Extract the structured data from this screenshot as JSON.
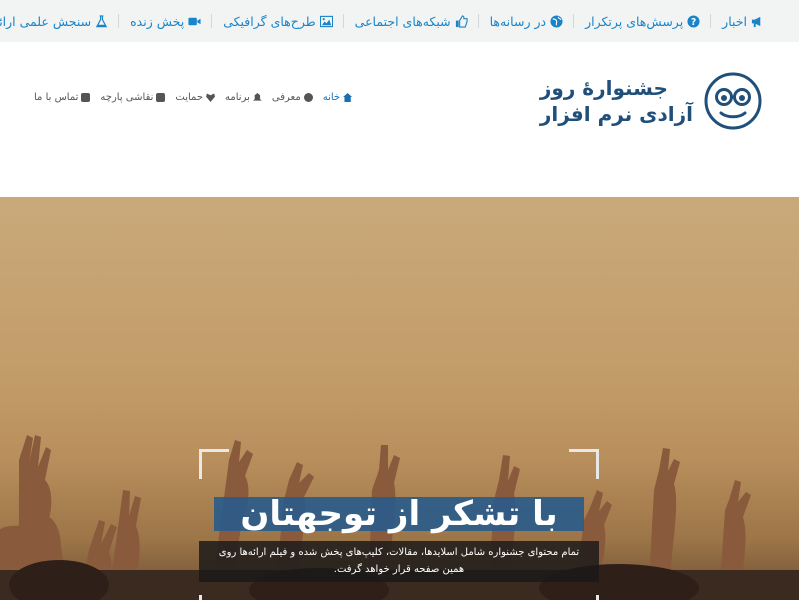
{
  "topbar": {
    "items": [
      {
        "label": "اخبار",
        "icon": "megaphone-icon"
      },
      {
        "label": "پرسش‌های پرتکرار",
        "icon": "question-icon"
      },
      {
        "label": "در رسانه‌ها",
        "icon": "globe-icon"
      },
      {
        "label": "شبکه‌های اجتماعی",
        "icon": "thumbs-up-icon"
      },
      {
        "label": "طرح‌های گرافیکی",
        "icon": "image-icon"
      },
      {
        "label": "پخش زنده",
        "icon": "video-camera-icon"
      },
      {
        "label": "سنجش علمی ارائه‌ها",
        "icon": "flask-icon"
      }
    ]
  },
  "logo": {
    "line1": "جشنوارهٔ روز",
    "line2": "آزادی نرم افزار"
  },
  "nav": {
    "items": [
      {
        "label": "خانه",
        "icon": "home-icon"
      },
      {
        "label": "معرفی",
        "icon": "info-icon"
      },
      {
        "label": "برنامه",
        "icon": "bell-icon"
      },
      {
        "label": "حمایت",
        "icon": "heart-icon"
      },
      {
        "label": "نقاشی پارچه",
        "icon": "edit-icon"
      },
      {
        "label": "تماس با ما",
        "icon": "phone-icon"
      }
    ]
  },
  "hero": {
    "title": "با تشکر از توجهتان",
    "description": "تمام محتوای جشنواره شامل اسلایدها، مقالات، کلیپ‌های پخش شده و فیلم ارائه‌ها روی همین صفحه قرار خواهد گرفت."
  },
  "colors": {
    "accent": "#1a84c8",
    "logo": "#20507a",
    "title_bg": "#265a8c"
  }
}
